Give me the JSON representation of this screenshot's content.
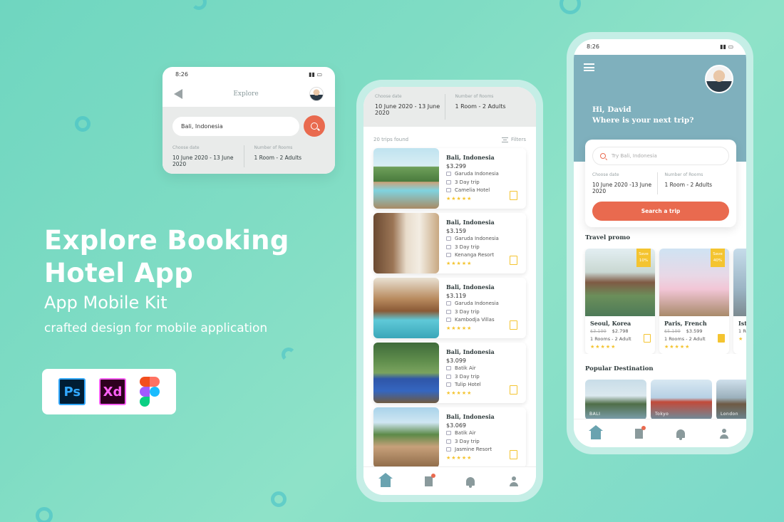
{
  "hero": {
    "title_line1": "Explore Booking",
    "title_line2": "Hotel App",
    "subtitle": "App Mobile Kit",
    "tagline": "crafted design for mobile application",
    "tools": [
      "Ps",
      "Xd",
      "Figma"
    ]
  },
  "explore_card": {
    "time": "8:26",
    "title": "Explore",
    "search_value": "Bali, Indonesia",
    "date_label": "Choose date",
    "date_value": "10 June 2020 - 13 June 2020",
    "rooms_label": "Number of Rooms",
    "rooms_value": "1 Room - 2 Adults"
  },
  "list_phone": {
    "date_label": "Choose date",
    "date_value": "10 June 2020 - 13 June 2020",
    "rooms_label": "Number of Rooms",
    "rooms_value": "1 Room - 2 Adults",
    "found": "20 trips found",
    "filters": "Filters",
    "hotels": [
      {
        "name": "Bali, Indonesia",
        "price": "$3.299",
        "airline": "Garuda Indonesia",
        "duration": "3 Day trip",
        "hotel": "Camelia Hotel",
        "stars": "★★★★★"
      },
      {
        "name": "Bali, Indonesia",
        "price": "$3.159",
        "airline": "Garuda Indonesia",
        "duration": "3 Day trip",
        "hotel": "Kenanga Resort",
        "stars": "★★★★★"
      },
      {
        "name": "Bali, Indonesia",
        "price": "$3.119",
        "airline": "Garuda Indonesia",
        "duration": "3 Day trip",
        "hotel": "Kambodja Villas",
        "stars": "★★★★★"
      },
      {
        "name": "Bali, Indonesia",
        "price": "$3.099",
        "airline": "Batik Air",
        "duration": "3 Day trip",
        "hotel": "Tulip Hotel",
        "stars": "★★★★★"
      },
      {
        "name": "Bali, Indonesia",
        "price": "$3.069",
        "airline": "Batik Air",
        "duration": "3 Day trip",
        "hotel": "Jasmine Resort",
        "stars": "★★★★★"
      }
    ]
  },
  "home_phone": {
    "time": "8:26",
    "greeting_line1": "Hi, David",
    "greeting_line2": "Where is your next trip?",
    "search_placeholder": "Try Bali, Indonesia",
    "date_label": "Choose date",
    "date_value": "10 June 2020 -13 June 2020",
    "rooms_label": "Number of Rooms",
    "rooms_value": "1 Room - 2 Adults",
    "search_button": "Search a trip",
    "promo_title": "Travel promo",
    "promos": [
      {
        "name": "Seoul, Korea",
        "old_price": "$3.199",
        "price": "$2.798",
        "rooms": "1 Rooms - 2 Adult",
        "stars": "★★★★★",
        "tag": "Save 10%"
      },
      {
        "name": "Paris, French",
        "old_price": "$5.199",
        "price": "$3.599",
        "rooms": "1 Rooms - 2 Adult",
        "stars": "★★★★★",
        "tag": "Save 40%"
      },
      {
        "name": "Ista",
        "old_price": "",
        "price": "",
        "rooms": "1 Ro",
        "stars": "★",
        "tag": ""
      }
    ],
    "destination_title": "Popular Destination",
    "destinations": [
      "BALI",
      "Tokyo",
      "London"
    ]
  },
  "colors": {
    "accent": "#e96a4f",
    "header": "#7fb0bd",
    "star": "#f4c430",
    "background": "#7fdcc4"
  }
}
